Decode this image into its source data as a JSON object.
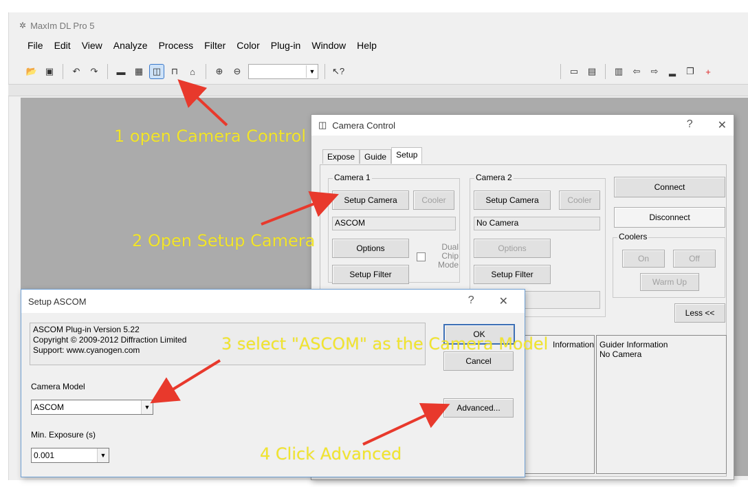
{
  "main_window": {
    "title": "MaxIm DL Pro 5",
    "menus": [
      "File",
      "Edit",
      "View",
      "Analyze",
      "Process",
      "Filter",
      "Color",
      "Plug-in",
      "Window",
      "Help"
    ]
  },
  "camera_control": {
    "title": "Camera Control",
    "help": "?",
    "close": "✕",
    "tabs": [
      "Expose",
      "Guide",
      "Setup"
    ],
    "camera1": {
      "legend": "Camera 1",
      "setup_camera": "Setup Camera",
      "cooler": "Cooler",
      "camera_name": "ASCOM",
      "options": "Options",
      "dual_chip_mode": "Dual Chip Mode",
      "setup_filter": "Setup Filter"
    },
    "camera2": {
      "legend": "Camera 2",
      "setup_camera": "Setup Camera",
      "cooler": "Cooler",
      "camera_name": "No Camera",
      "options": "Options",
      "setup_filter": "Setup Filter"
    },
    "connect": "Connect",
    "disconnect": "Disconnect",
    "coolers": {
      "legend": "Coolers",
      "on": "On",
      "off": "Off",
      "warm_up": "Warm Up"
    },
    "less": "Less <<",
    "info_partial": "Information",
    "guider_info_title": "Guider Information",
    "guider_info_value": "No Camera"
  },
  "setup_ascom": {
    "title": "Setup ASCOM",
    "help": "?",
    "close": "✕",
    "version": "ASCOM Plug-in Version 5.22",
    "copyright": "Copyright © 2009-2012 Diffraction Limited",
    "support": "Support: www.cyanogen.com",
    "ok": "OK",
    "cancel": "Cancel",
    "camera_model_label": "Camera Model",
    "camera_model_value": "ASCOM",
    "advanced": "Advanced...",
    "min_exposure_label": "Min. Exposure (s)",
    "min_exposure_value": "0.001"
  },
  "annotations": {
    "step1": "1 open Camera Control",
    "step2": "2 Open Setup Camera",
    "step3": "3 select \"ASCOM\" as the Camera Model",
    "step4": "4 Click Advanced"
  },
  "colors": {
    "annotation": "#f2e52c",
    "arrow": "#e8392c"
  }
}
